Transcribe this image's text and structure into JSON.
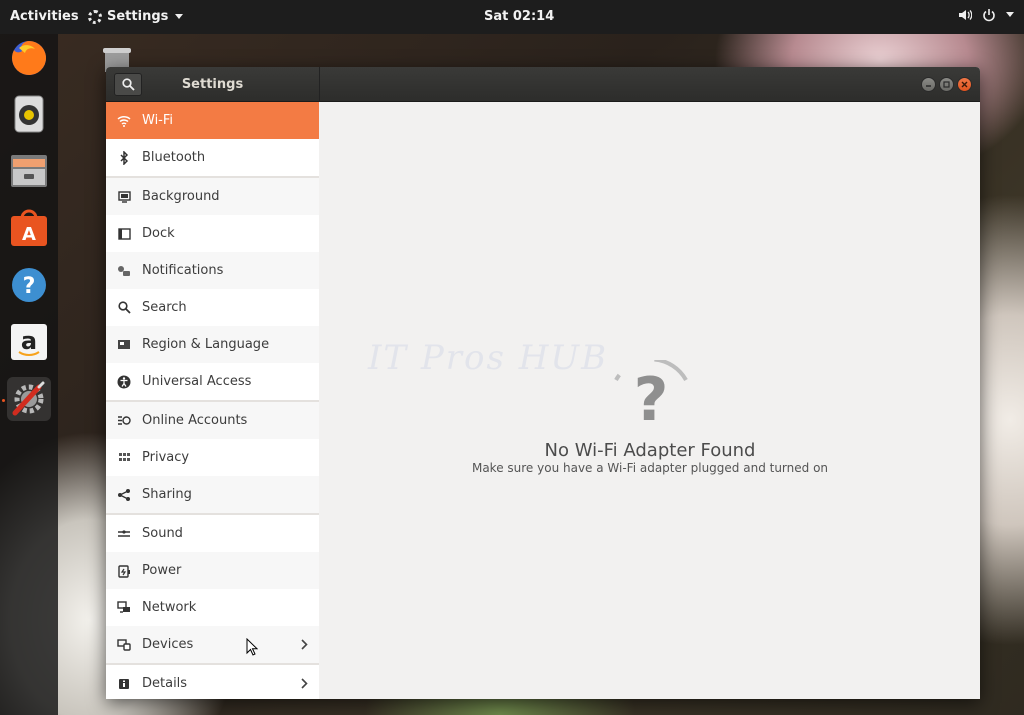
{
  "topbar": {
    "activities": "Activities",
    "app_menu": "Settings",
    "clock": "Sat 02:14",
    "tray_icons": [
      "speaker-icon",
      "power-icon",
      "chevron-down-icon"
    ]
  },
  "dock": {
    "items": [
      "firefox-icon",
      "rhythmbox-icon",
      "files-icon",
      "software-icon",
      "help-icon",
      "amazon-icon",
      "settings-icon"
    ]
  },
  "window": {
    "title": "Settings",
    "buttons": [
      "minimize-icon",
      "maximize-icon",
      "close-icon"
    ]
  },
  "sidebar": {
    "items": [
      {
        "label": "Wi-Fi",
        "icon": "wifi-icon"
      },
      {
        "label": "Bluetooth",
        "icon": "bluetooth-icon"
      },
      {
        "label": "Background",
        "icon": "background-icon"
      },
      {
        "label": "Dock",
        "icon": "dock-icon"
      },
      {
        "label": "Notifications",
        "icon": "notifications-icon"
      },
      {
        "label": "Search",
        "icon": "search-icon"
      },
      {
        "label": "Region & Language",
        "icon": "region-icon"
      },
      {
        "label": "Universal Access",
        "icon": "accessibility-icon"
      },
      {
        "label": "Online Accounts",
        "icon": "online-accounts-icon"
      },
      {
        "label": "Privacy",
        "icon": "privacy-icon"
      },
      {
        "label": "Sharing",
        "icon": "sharing-icon"
      },
      {
        "label": "Sound",
        "icon": "sound-icon"
      },
      {
        "label": "Power",
        "icon": "power-icon"
      },
      {
        "label": "Network",
        "icon": "network-icon"
      },
      {
        "label": "Devices",
        "icon": "devices-icon"
      },
      {
        "label": "Details",
        "icon": "details-icon"
      }
    ]
  },
  "content": {
    "watermark": "IT Pros HUB",
    "empty_title": "No Wi-Fi Adapter Found",
    "empty_subtitle": "Make sure you have a Wi-Fi adapter plugged and turned on"
  },
  "colors": {
    "accent": "#f37b44",
    "close_button": "#e0541f",
    "headerbar": "#2d2d2b"
  }
}
